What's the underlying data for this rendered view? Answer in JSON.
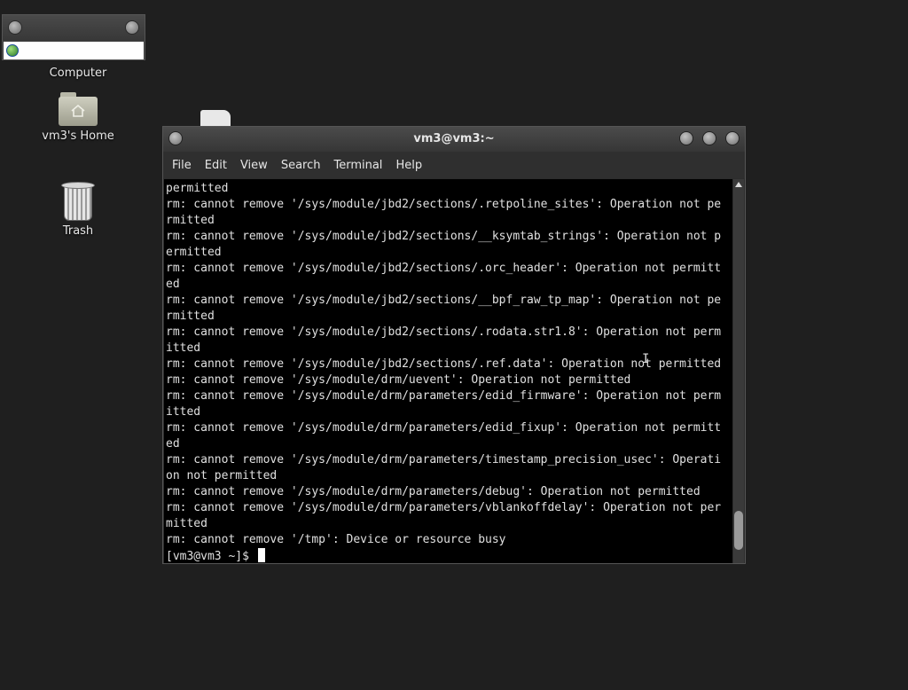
{
  "desktop": {
    "icons": [
      {
        "label": "Computer"
      },
      {
        "label": "vm3's Home"
      },
      {
        "label": "Trash"
      }
    ]
  },
  "terminal": {
    "title": "vm3@vm3:~",
    "menu": [
      "File",
      "Edit",
      "View",
      "Search",
      "Terminal",
      "Help"
    ],
    "lines": [
      "permitted",
      "rm: cannot remove '/sys/module/jbd2/sections/.retpoline_sites': Operation not pe",
      "rmitted",
      "rm: cannot remove '/sys/module/jbd2/sections/__ksymtab_strings': Operation not p",
      "ermitted",
      "rm: cannot remove '/sys/module/jbd2/sections/.orc_header': Operation not permitt",
      "ed",
      "rm: cannot remove '/sys/module/jbd2/sections/__bpf_raw_tp_map': Operation not pe",
      "rmitted",
      "rm: cannot remove '/sys/module/jbd2/sections/.rodata.str1.8': Operation not perm",
      "itted",
      "rm: cannot remove '/sys/module/jbd2/sections/.ref.data': Operation not permitted",
      "rm: cannot remove '/sys/module/drm/uevent': Operation not permitted",
      "rm: cannot remove '/sys/module/drm/parameters/edid_firmware': Operation not perm",
      "itted",
      "rm: cannot remove '/sys/module/drm/parameters/edid_fixup': Operation not permitt",
      "ed",
      "rm: cannot remove '/sys/module/drm/parameters/timestamp_precision_usec': Operati",
      "on not permitted",
      "rm: cannot remove '/sys/module/drm/parameters/debug': Operation not permitted",
      "rm: cannot remove '/sys/module/drm/parameters/vblankoffdelay': Operation not per",
      "mitted",
      "rm: cannot remove '/tmp': Device or resource busy"
    ],
    "prompt": "[vm3@vm3 ~]$ "
  }
}
